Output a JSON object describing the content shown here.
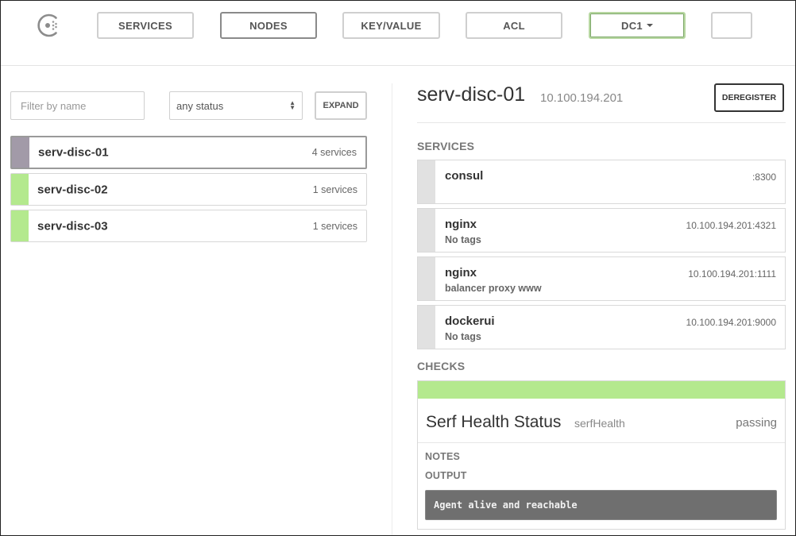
{
  "nav": {
    "items": [
      {
        "label": "SERVICES",
        "active": false
      },
      {
        "label": "NODES",
        "active": true
      },
      {
        "label": "KEY/VALUE",
        "active": false
      },
      {
        "label": "ACL",
        "active": false
      }
    ],
    "datacenter": "DC1",
    "extra_button_label": ""
  },
  "filter": {
    "placeholder": "Filter by name",
    "status_value": "any status",
    "expand_label": "EXPAND"
  },
  "nodes": [
    {
      "name": "serv-disc-01",
      "count": "4 services",
      "status_color": "#a29aa8",
      "selected": true
    },
    {
      "name": "serv-disc-02",
      "count": "1 services",
      "status_color": "#b4e98e",
      "selected": false
    },
    {
      "name": "serv-disc-03",
      "count": "1 services",
      "status_color": "#b4e98e",
      "selected": false
    }
  ],
  "detail": {
    "title": "serv-disc-01",
    "ip": "10.100.194.201",
    "deregister_label": "DEREGISTER",
    "services_heading": "SERVICES",
    "services": [
      {
        "name": "consul",
        "tags": "",
        "address": ":8300"
      },
      {
        "name": "nginx",
        "tags": "No tags",
        "address": "10.100.194.201:4321"
      },
      {
        "name": "nginx",
        "tags": "balancer proxy www",
        "address": "10.100.194.201:1111"
      },
      {
        "name": "dockerui",
        "tags": "No tags",
        "address": "10.100.194.201:9000"
      }
    ],
    "checks_heading": "CHECKS",
    "check": {
      "name": "Serf Health Status",
      "id": "serfHealth",
      "status": "passing",
      "status_color": "#b4e98e",
      "notes_label": "NOTES",
      "output_label": "OUTPUT",
      "output": "Agent alive and reachable"
    }
  }
}
